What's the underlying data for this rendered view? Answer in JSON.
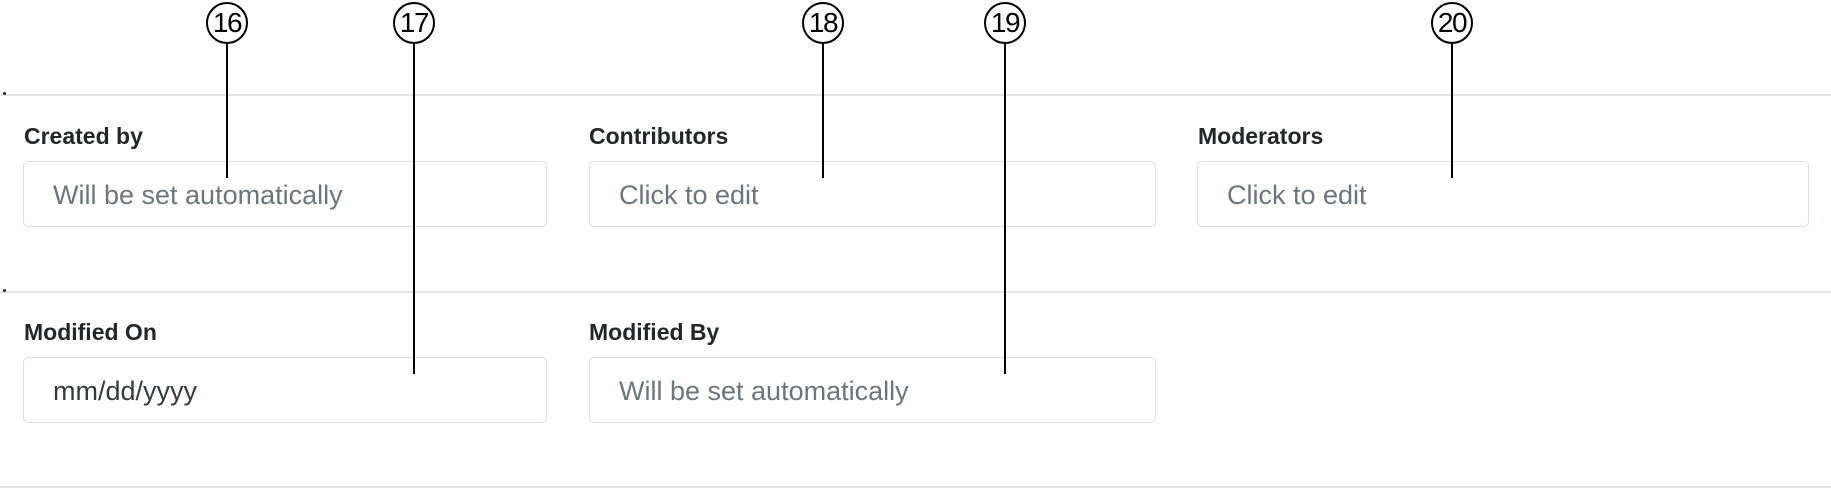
{
  "callouts": [
    "16",
    "17",
    "18",
    "19",
    "20"
  ],
  "row1": {
    "created_by": {
      "label": "Created by",
      "placeholder": "Will be set automatically"
    },
    "contributors": {
      "label": "Contributors",
      "placeholder": "Click to edit"
    },
    "moderators": {
      "label": "Moderators",
      "placeholder": "Click to edit"
    }
  },
  "row2": {
    "modified_on": {
      "label": "Modified On",
      "placeholder": "mm/dd/yyyy"
    },
    "modified_by": {
      "label": "Modified By",
      "placeholder": "Will be set automatically"
    }
  }
}
